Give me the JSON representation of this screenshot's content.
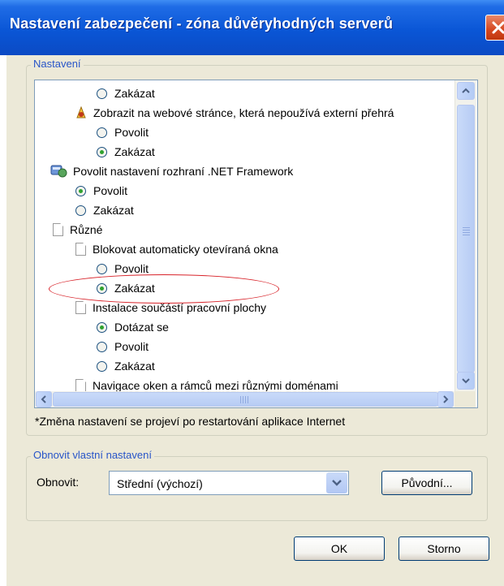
{
  "window": {
    "title": "Nastavení zabezpečení - zóna důvěryhodných serverů"
  },
  "settings_group": {
    "legend": "Nastavení",
    "items": [
      {
        "kind": "radio",
        "label": "Zakázat",
        "checked": false
      },
      {
        "kind": "media",
        "label": "Zobrazit na webové stránce, která nepoužívá externí přehrá"
      },
      {
        "kind": "radio",
        "label": "Povolit",
        "checked": false
      },
      {
        "kind": "radio",
        "label": "Zakázat",
        "checked": true
      },
      {
        "kind": "net",
        "label": "Povolit nastavení rozhraní .NET Framework"
      },
      {
        "kind": "radio",
        "label": "Povolit",
        "checked": true
      },
      {
        "kind": "radio",
        "label": "Zakázat",
        "checked": false
      },
      {
        "kind": "doc",
        "label": "Různé"
      },
      {
        "kind": "doc",
        "label": "Blokovat automaticky otevíraná okna"
      },
      {
        "kind": "radio",
        "label": "Povolit",
        "checked": false
      },
      {
        "kind": "radio",
        "label": "Zakázat",
        "checked": true
      },
      {
        "kind": "doc",
        "label": "Instalace součástí pracovní plochy"
      },
      {
        "kind": "radio",
        "label": "Dotázat se",
        "checked": true
      },
      {
        "kind": "radio",
        "label": "Povolit",
        "checked": false
      },
      {
        "kind": "radio",
        "label": "Zakázat",
        "checked": false
      },
      {
        "kind": "doc",
        "label": "Navigace oken a rámců mezi různými doménami"
      }
    ],
    "note": "*Změna nastavení se projeví po restartování aplikace Internet"
  },
  "reset_group": {
    "legend": "Obnovit vlastní nastavení",
    "reset_label": "Obnovit:",
    "combo_value": "Střední (výchozí)",
    "reset_button": "Původní..."
  },
  "buttons": {
    "ok": "OK",
    "cancel": "Storno"
  },
  "colors": {
    "titlebar": "#0a56d6",
    "dialog_bg": "#ece9d8",
    "highlight_ellipse": "#d8232a",
    "legend_text": "#2855c8"
  }
}
